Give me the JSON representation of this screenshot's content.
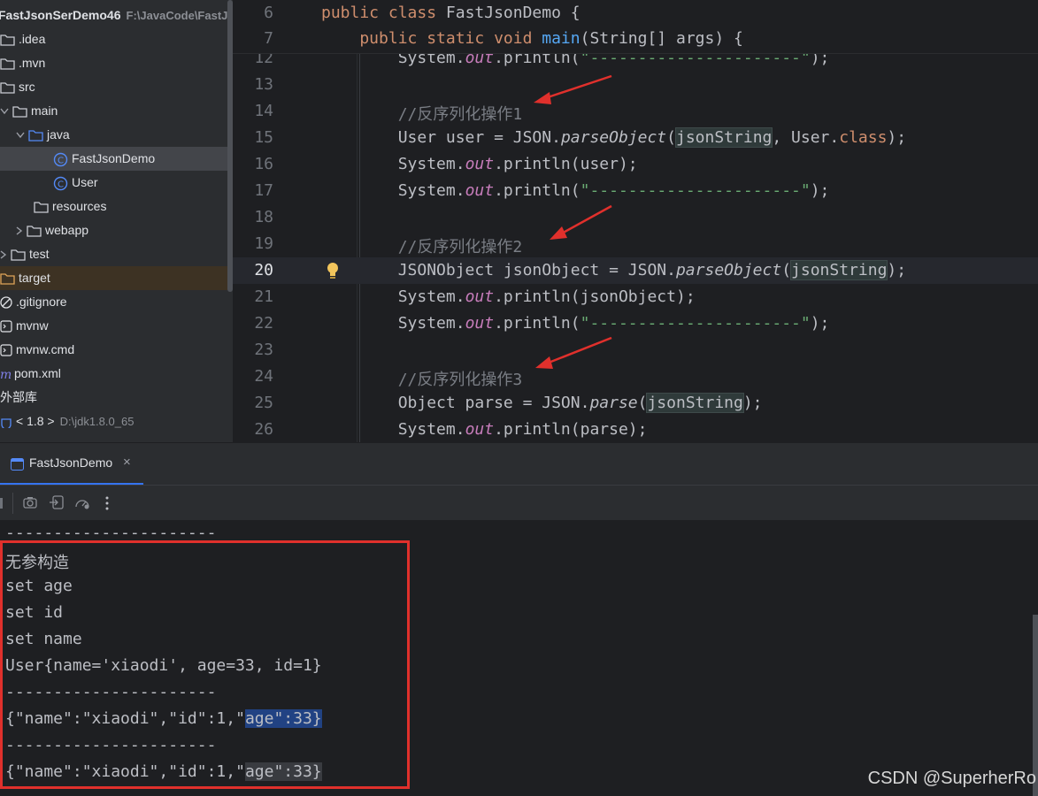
{
  "project": {
    "root_name": "FastJsonSerDemo46",
    "root_path": "F:\\JavaCode\\FastJs",
    "items": [
      {
        "label": "FastJsonSerDemo46",
        "sub": "F:\\JavaCode\\FastJs"
      },
      {
        "label": ".idea"
      },
      {
        "label": ".mvn"
      },
      {
        "label": "src"
      },
      {
        "label": "main"
      },
      {
        "label": "java"
      },
      {
        "label": "FastJsonDemo"
      },
      {
        "label": "User"
      },
      {
        "label": "resources"
      },
      {
        "label": "webapp"
      },
      {
        "label": "test"
      },
      {
        "label": "target"
      },
      {
        "label": ".gitignore"
      },
      {
        "label": "mvnw"
      },
      {
        "label": "mvnw.cmd"
      },
      {
        "label": "pom.xml"
      },
      {
        "label": "外部库"
      },
      {
        "label": "< 1.8 >",
        "sub": "D:\\jdk1.8.0_65"
      }
    ]
  },
  "editor": {
    "sticky": [
      {
        "num": "6",
        "parts": [
          {
            "t": "public class ",
            "c": "kw"
          },
          {
            "t": "FastJsonDemo {",
            "c": ""
          }
        ]
      },
      {
        "num": "7",
        "parts": [
          {
            "t": "    public static void ",
            "c": "kw"
          },
          {
            "t": "main",
            "c": "fn"
          },
          {
            "t": "(String[] args) {",
            "c": ""
          }
        ]
      }
    ],
    "lines": [
      {
        "num": "12",
        "parts": [
          {
            "t": "        System.",
            "c": ""
          },
          {
            "t": "out",
            "c": "fld"
          },
          {
            "t": ".println(",
            "c": ""
          },
          {
            "t": "\"----------------------\"",
            "c": "str"
          },
          {
            "t": ");",
            "c": ""
          }
        ]
      },
      {
        "num": "13",
        "parts": []
      },
      {
        "num": "14",
        "parts": [
          {
            "t": "        //反序列化操作1",
            "c": "cm"
          }
        ]
      },
      {
        "num": "15",
        "parts": [
          {
            "t": "        User user = JSON.",
            "c": ""
          },
          {
            "t": "parseObject",
            "c": "it"
          },
          {
            "t": "(",
            "c": ""
          },
          {
            "t": "jsonString",
            "c": "hl"
          },
          {
            "t": ", User.",
            "c": ""
          },
          {
            "t": "class",
            "c": "kw"
          },
          {
            "t": ");",
            "c": ""
          }
        ]
      },
      {
        "num": "16",
        "parts": [
          {
            "t": "        System.",
            "c": ""
          },
          {
            "t": "out",
            "c": "fld"
          },
          {
            "t": ".println(user);",
            "c": ""
          }
        ]
      },
      {
        "num": "17",
        "parts": [
          {
            "t": "        System.",
            "c": ""
          },
          {
            "t": "out",
            "c": "fld"
          },
          {
            "t": ".println(",
            "c": ""
          },
          {
            "t": "\"----------------------\"",
            "c": "str"
          },
          {
            "t": ");",
            "c": ""
          }
        ]
      },
      {
        "num": "18",
        "parts": []
      },
      {
        "num": "19",
        "parts": [
          {
            "t": "        //反序列化操作2",
            "c": "cm"
          }
        ]
      },
      {
        "num": "20",
        "parts": [
          {
            "t": "        JSONObject jsonObject = JSON.",
            "c": ""
          },
          {
            "t": "parseObject",
            "c": "it"
          },
          {
            "t": "(",
            "c": ""
          },
          {
            "t": "jsonString",
            "c": "hl"
          },
          {
            "t": ");",
            "c": ""
          }
        ]
      },
      {
        "num": "21",
        "parts": [
          {
            "t": "        System.",
            "c": ""
          },
          {
            "t": "out",
            "c": "fld"
          },
          {
            "t": ".println(jsonObject);",
            "c": ""
          }
        ]
      },
      {
        "num": "22",
        "parts": [
          {
            "t": "        System.",
            "c": ""
          },
          {
            "t": "out",
            "c": "fld"
          },
          {
            "t": ".println(",
            "c": ""
          },
          {
            "t": "\"----------------------\"",
            "c": "str"
          },
          {
            "t": ");",
            "c": ""
          }
        ]
      },
      {
        "num": "23",
        "parts": []
      },
      {
        "num": "24",
        "parts": [
          {
            "t": "        //反序列化操作3",
            "c": "cm"
          }
        ]
      },
      {
        "num": "25",
        "parts": [
          {
            "t": "        Object parse = JSON.",
            "c": ""
          },
          {
            "t": "parse",
            "c": "it"
          },
          {
            "t": "(",
            "c": ""
          },
          {
            "t": "jsonString",
            "c": "hl"
          },
          {
            "t": ");",
            "c": ""
          }
        ]
      },
      {
        "num": "26",
        "parts": [
          {
            "t": "        System.",
            "c": ""
          },
          {
            "t": "out",
            "c": "fld"
          },
          {
            "t": ".println(parse);",
            "c": ""
          }
        ]
      }
    ],
    "active_line": "20"
  },
  "run": {
    "tab_label": "FastJsonDemo",
    "close_glyph": "×"
  },
  "console": {
    "lines": [
      {
        "parts": [
          {
            "t": "----------------------",
            "c": ""
          }
        ]
      },
      {
        "parts": [
          {
            "t": "无参构造",
            "c": ""
          }
        ]
      },
      {
        "parts": [
          {
            "t": "set age",
            "c": ""
          }
        ]
      },
      {
        "parts": [
          {
            "t": "set id",
            "c": ""
          }
        ]
      },
      {
        "parts": [
          {
            "t": "set name",
            "c": ""
          }
        ]
      },
      {
        "parts": [
          {
            "t": "User{name='xiaodi', age=33, id=1}",
            "c": ""
          }
        ]
      },
      {
        "parts": [
          {
            "t": "----------------------",
            "c": ""
          }
        ]
      },
      {
        "parts": [
          {
            "t": "{\"name\":\"xiaodi\",\"id\":1,\"",
            "c": ""
          },
          {
            "t": "age\":33}",
            "c": "sel"
          }
        ]
      },
      {
        "parts": [
          {
            "t": "----------------------",
            "c": ""
          }
        ]
      },
      {
        "parts": [
          {
            "t": "{\"name\":\"xiaodi\",\"id\":1,\"",
            "c": ""
          },
          {
            "t": "age\":33}",
            "c": "dim"
          }
        ]
      }
    ]
  },
  "watermark": "CSDN @SuperherRo",
  "colors": {
    "accent": "#3574f0",
    "annotation_red": "#e0302c"
  }
}
